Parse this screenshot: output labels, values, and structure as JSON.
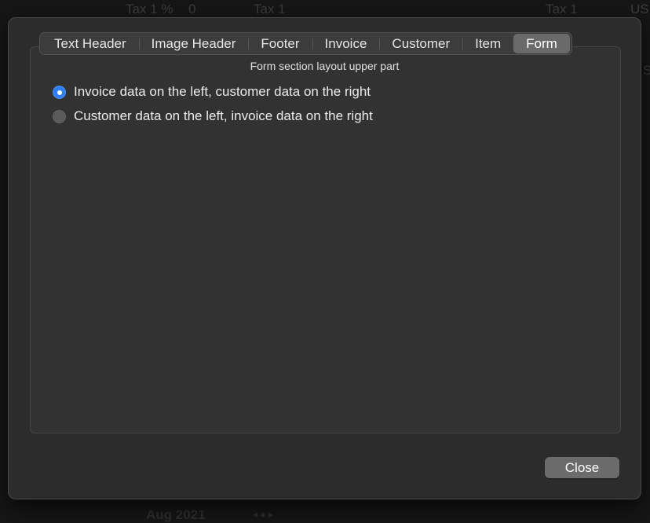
{
  "background": {
    "top_labels": [
      "Tax 1 %",
      "0",
      "Tax 1",
      "Tax 1",
      "US"
    ],
    "side_label_right": "S",
    "footer_date": "Aug 2021",
    "footer_nav": "◂ ● ▸"
  },
  "dialog": {
    "tabs": [
      {
        "label": "Text Header"
      },
      {
        "label": "Image Header"
      },
      {
        "label": "Footer"
      },
      {
        "label": "Invoice"
      },
      {
        "label": "Customer"
      },
      {
        "label": "Item"
      },
      {
        "label": "Form"
      }
    ],
    "active_tab": "Form",
    "section_title": "Form section layout upper part",
    "options": [
      {
        "label": "Invoice data on the left, customer data on the right",
        "selected": true
      },
      {
        "label": "Customer data on the left, invoice data on the right",
        "selected": false
      }
    ],
    "close_label": "Close"
  },
  "colors": {
    "accent": "#2f7ff0",
    "sheet_bg": "#2c2c2c",
    "active_tab": "#6a6a6a"
  }
}
